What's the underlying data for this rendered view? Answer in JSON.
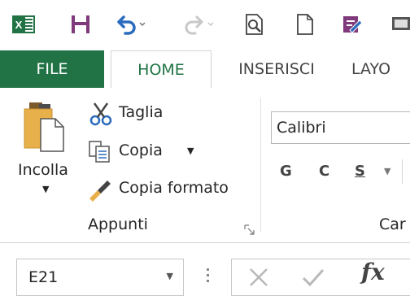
{
  "quick_access": {
    "icons": [
      "excel-logo-icon",
      "save-icon",
      "undo-icon",
      "redo-icon",
      "print-preview-icon",
      "new-document-icon",
      "form-edit-icon",
      "screen-icon"
    ]
  },
  "tabs": [
    {
      "label": "FILE"
    },
    {
      "label": "HOME"
    },
    {
      "label": "INSERISCI"
    },
    {
      "label": "LAYO"
    }
  ],
  "clipboard": {
    "paste_label": "Incolla",
    "cut_label": "Taglia",
    "copy_label": "Copia",
    "format_painter_label": "Copia formato",
    "group_label": "Appunti"
  },
  "font": {
    "name": "Calibri",
    "bold": "G",
    "italic": "C",
    "underline": "S",
    "group_label_partial": "Car"
  },
  "formula_bar": {
    "name_box_value": "E21",
    "fx_label": "fx"
  },
  "colors": {
    "excel_green": "#217346",
    "save_purple": "#80397b",
    "undo_blue": "#2b6bbd"
  }
}
